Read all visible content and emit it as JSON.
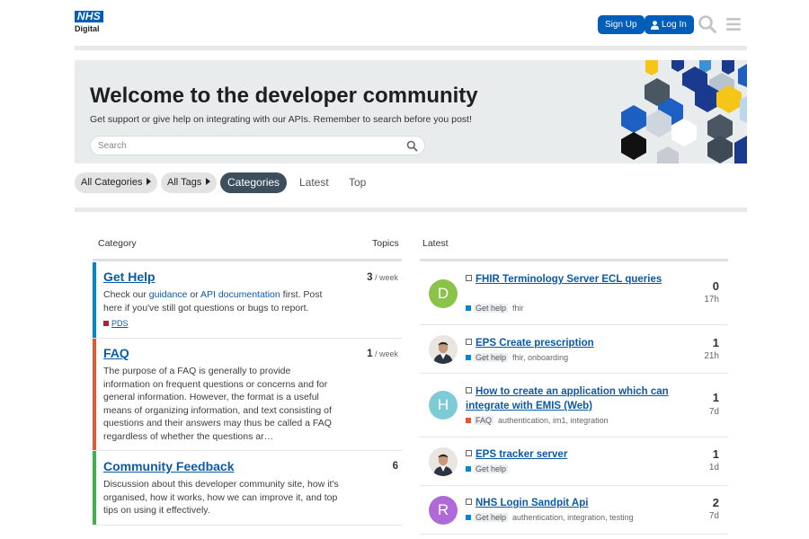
{
  "header": {
    "logo_top": "NHS",
    "logo_bottom": "Digital",
    "signup_label": "Sign Up",
    "login_label": "Log In",
    "colors": {
      "brand": "#005eb8"
    }
  },
  "banner": {
    "title": "Welcome to the developer community",
    "subtitle": "Get support or give help on integrating with our APIs. Remember to search before you post!",
    "search_placeholder": "Search"
  },
  "nav": {
    "all_categories": "All Categories",
    "all_tags": "All Tags",
    "tabs": [
      "Categories",
      "Latest",
      "Top"
    ],
    "active_tab": "Categories"
  },
  "categories": {
    "header_category": "Category",
    "header_topics": "Topics",
    "items": [
      {
        "title": "Get Help",
        "color": "#0088cc",
        "desc_pre": "Check our ",
        "desc_link1": "guidance",
        "desc_mid": " or ",
        "desc_link2": "API documentation",
        "desc_post": " first. Post here if you've still got questions or bugs to report.",
        "count": "3",
        "per": " / week",
        "subcategory": "PDS"
      },
      {
        "title": "FAQ",
        "color": "#e45735",
        "description": "The purpose of a FAQ is generally to provide information on frequent questions or concerns and for general information. However, the format is a useful means of organizing information, and text consisting of questions and their answers may thus be called a FAQ regardless of whether the questions ar…",
        "count": "1",
        "per": " / week"
      },
      {
        "title": "Community Feedback",
        "color": "#3ab54a",
        "description": "Discussion about this developer community site, how it's organised, how it works, how we can improve it, and top tips on using it effectively.",
        "count": "6"
      }
    ]
  },
  "latest": {
    "header": "Latest",
    "topics": [
      {
        "avatar_letter": "D",
        "avatar_color": "#8bc34a",
        "title": "FHIR Terminology Server ECL queries",
        "category": "Get help",
        "category_color": "#0088cc",
        "tags": "fhir",
        "replies": "0",
        "age": "17h"
      },
      {
        "avatar_letter": "",
        "avatar_color": "photo",
        "title": "EPS Create prescription",
        "category": "Get help",
        "category_color": "#0088cc",
        "tags": "fhir, onboarding",
        "replies": "1",
        "age": "21h"
      },
      {
        "avatar_letter": "H",
        "avatar_color": "#7ecbd8",
        "title": "How to create an application which can integrate with EMIS (Web)",
        "category": "FAQ",
        "category_color": "#e45735",
        "tags": "authentication, im1, integration",
        "replies": "1",
        "age": "7d"
      },
      {
        "avatar_letter": "",
        "avatar_color": "photo",
        "title": "EPS tracker server",
        "category": "Get help",
        "category_color": "#0088cc",
        "tags": "",
        "replies": "1",
        "age": "1d"
      },
      {
        "avatar_letter": "R",
        "avatar_color": "#b06ad8",
        "title": "NHS Login Sandpit Api",
        "category": "Get help",
        "category_color": "#0088cc",
        "tags": "authentication, integration, testing",
        "replies": "2",
        "age": "7d"
      }
    ]
  }
}
